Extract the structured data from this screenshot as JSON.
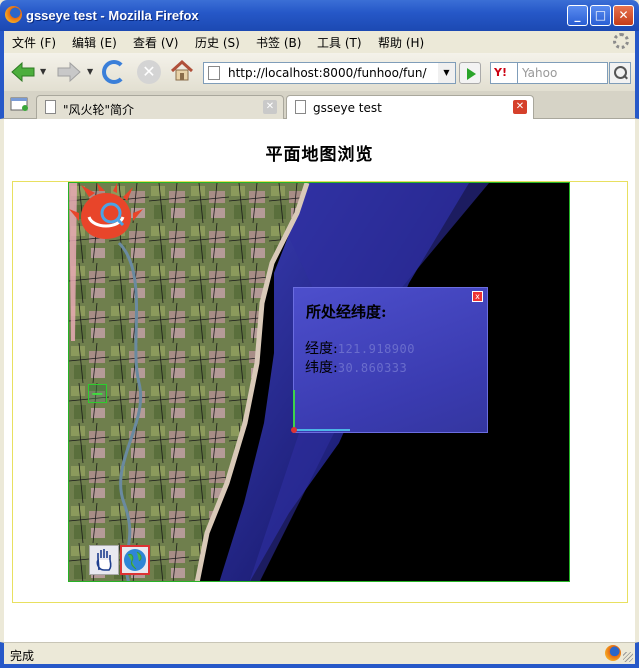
{
  "window": {
    "title": "gsseye test - Mozilla Firefox",
    "minimize_glyph": "_",
    "maximize_glyph": "□",
    "close_glyph": "✕"
  },
  "menu": {
    "items": [
      "文件 (F)",
      "编辑 (E)",
      "查看 (V)",
      "历史 (S)",
      "书签 (B)",
      "工具 (T)",
      "帮助 (H)"
    ]
  },
  "nav": {
    "url": "http://localhost:8000/funhoo/fun/",
    "search_engine": "Y!",
    "search_placeholder": "Yahoo",
    "dropdown_glyph": "▼",
    "stop_glyph": "✕"
  },
  "tabs": [
    {
      "label": "\"风火轮\"简介",
      "active": false,
      "close_glyph": "✕"
    },
    {
      "label": "gsseye test",
      "active": true,
      "close_glyph": "✕"
    }
  ],
  "page": {
    "heading": "平面地图浏览"
  },
  "map": {
    "zoom_in": "+",
    "zoom_out": "−",
    "popup": {
      "title": "所处经纬度:",
      "lon_label": "经度:",
      "lon_value": "121.918900",
      "lat_label": "纬度:",
      "lat_value": "30.860333",
      "close_glyph": "x"
    }
  },
  "status": {
    "text": "完成"
  }
}
